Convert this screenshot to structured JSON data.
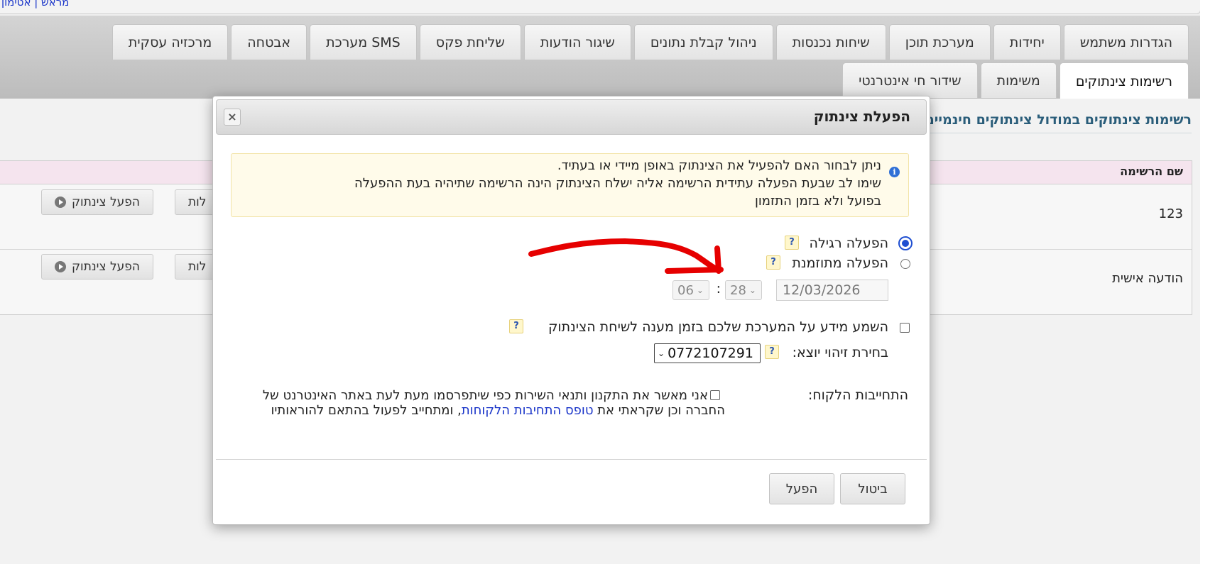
{
  "topbar": {
    "link_text": "מראש | אטימון"
  },
  "tabs_row1": [
    "הגדרות משתמש",
    "יחידות",
    "מערכת תוכן",
    "שיחות נכנסות",
    "ניהול קבלת נתונים",
    "שיגור הודעות",
    "שליחת פקס",
    "מערכת SMS",
    "אבטחה",
    "מרכזיה עסקית"
  ],
  "tabs_row2": [
    "רשימות צינתוקים",
    "משימות",
    "שידור חי אינטרנטי"
  ],
  "content": {
    "title": "רשימות צינתוקים במודול צינתוקים חינמיים",
    "table_header": "שם הרשימה",
    "rows": [
      {
        "name": "123",
        "partial_button": "לות",
        "activate_button": "הפעל צינתוק"
      },
      {
        "name": "הודעה אישית",
        "partial_button": "לות",
        "activate_button": "הפעל צינתוק"
      }
    ]
  },
  "modal": {
    "title": "הפעלת צינתוק",
    "close_label": "×",
    "notice": {
      "line1": "ניתן לבחור האם להפעיל את הצינתוק באופן מיידי או בעתיד.",
      "line2": "שימו לב שבעת הפעלה עתידית הרשימה אליה ישלח הצינתוק הינה הרשימה שתיהיה בעת ההפעלה",
      "line3": "בפועל ולא בזמן התזמון"
    },
    "options": {
      "regular_label": "הפעלה רגילה",
      "scheduled_label": "הפעלה מתוזמנת",
      "selected": "regular"
    },
    "schedule": {
      "date": "12/03/2026",
      "minute": "28",
      "separator": ":",
      "hour": "06"
    },
    "notify_label": "השמע מידע על המערכת שלכם בזמן מענה לשיחת הצינתוק",
    "callerid": {
      "label": "בחירת זיהוי יוצא:",
      "value": "0772107291"
    },
    "commitment": {
      "label": "התחייבות הלקוח:",
      "text_before": "אני מאשר את התקנון ותנאי השירות כפי שיתפרסמו מעת לעת באתר האינטרנט של החברה וכן שקראתי את ",
      "link_text": "טופס התחיבות הלקוחות",
      "text_after": ", ומתחייב לפעול בהתאם להוראותיו"
    },
    "buttons": {
      "cancel": "ביטול",
      "activate": "הפעל"
    },
    "help_mark": "?"
  },
  "colors": {
    "annotation": "#e60000",
    "link": "#1a35c9",
    "radio_selected": "#1f4fd1"
  }
}
